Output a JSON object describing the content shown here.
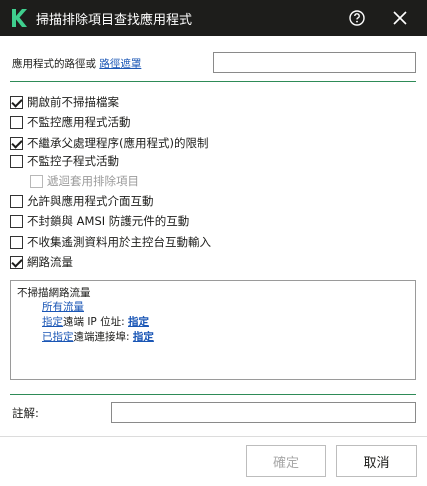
{
  "window": {
    "title": "掃描排除項目查找應用程式",
    "logo_icon": "kaspersky-k-icon",
    "help_icon": "question-circle-icon",
    "close_icon": "close-x-icon",
    "accent_color": "#2e8b57",
    "titlebar_color": "#1d1d1b"
  },
  "path": {
    "label": "應用程式的路徑或",
    "link": "路徑遮罩",
    "value": ""
  },
  "options": [
    {
      "label": "開啟前不掃描檔案",
      "checked": true,
      "disabled": false
    },
    {
      "label": "不監控應用程式活動",
      "checked": false,
      "disabled": false
    },
    {
      "label": "不繼承父處理程序(應用程式)的限制",
      "checked": true,
      "disabled": false
    },
    {
      "label": "不監控子程式活動",
      "checked": false,
      "disabled": false
    },
    {
      "label": "遞迴套用排除項目",
      "checked": false,
      "disabled": true
    },
    {
      "label": "允許與應用程式介面互動",
      "checked": false,
      "disabled": false
    },
    {
      "label": "不封鎖與 AMSI 防護元件的互動",
      "checked": false,
      "disabled": false
    },
    {
      "label": "不收集遙測資料用於主控台互動輸入",
      "checked": false,
      "disabled": false
    },
    {
      "label": "網路流量",
      "checked": true,
      "disabled": false
    }
  ],
  "network": {
    "title": "不掃描網路流量",
    "all_traffic": "所有流量",
    "remote_ip_prefix_link": "指定",
    "remote_ip_text": "遠端 IP 位址:",
    "remote_ip_action": "指定",
    "remote_port_prefix_link": "已指定",
    "remote_port_text": "遠端連接埠:",
    "remote_port_action": "指定"
  },
  "note": {
    "label": "註解:",
    "value": ""
  },
  "buttons": {
    "ok": "確定",
    "cancel": "取消"
  }
}
